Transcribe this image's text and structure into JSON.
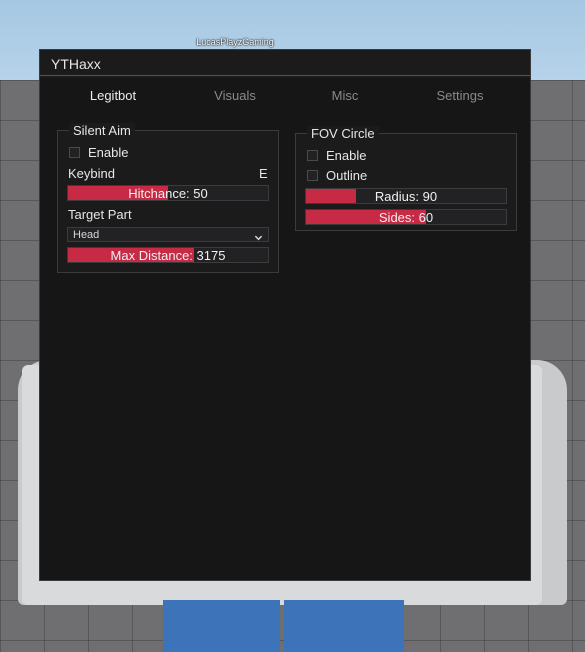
{
  "player_name": "LucasPlayzGaming",
  "window": {
    "title": "YTHaxx",
    "accent": "#c62a45"
  },
  "tabs": [
    {
      "label": "Legitbot",
      "active": true
    },
    {
      "label": "Visuals",
      "active": false
    },
    {
      "label": "Misc",
      "active": false
    },
    {
      "label": "Settings",
      "active": false
    }
  ],
  "silent_aim": {
    "title": "Silent Aim",
    "enable_label": "Enable",
    "enabled": false,
    "keybind_label": "Keybind",
    "keybind_value": "E",
    "hitchance": {
      "label": "Hitchance: 50",
      "fraction": 0.5
    },
    "target_part_label": "Target Part",
    "target_part_value": "Head",
    "max_distance": {
      "label": "Max Distance: 3175",
      "fraction": 0.63
    }
  },
  "fov_circle": {
    "title": "FOV Circle",
    "enable_label": "Enable",
    "enabled": false,
    "outline_label": "Outline",
    "outline": false,
    "radius": {
      "label": "Radius: 90",
      "fraction": 0.25
    },
    "sides": {
      "label": "Sides: 60",
      "fraction": 0.6
    }
  }
}
